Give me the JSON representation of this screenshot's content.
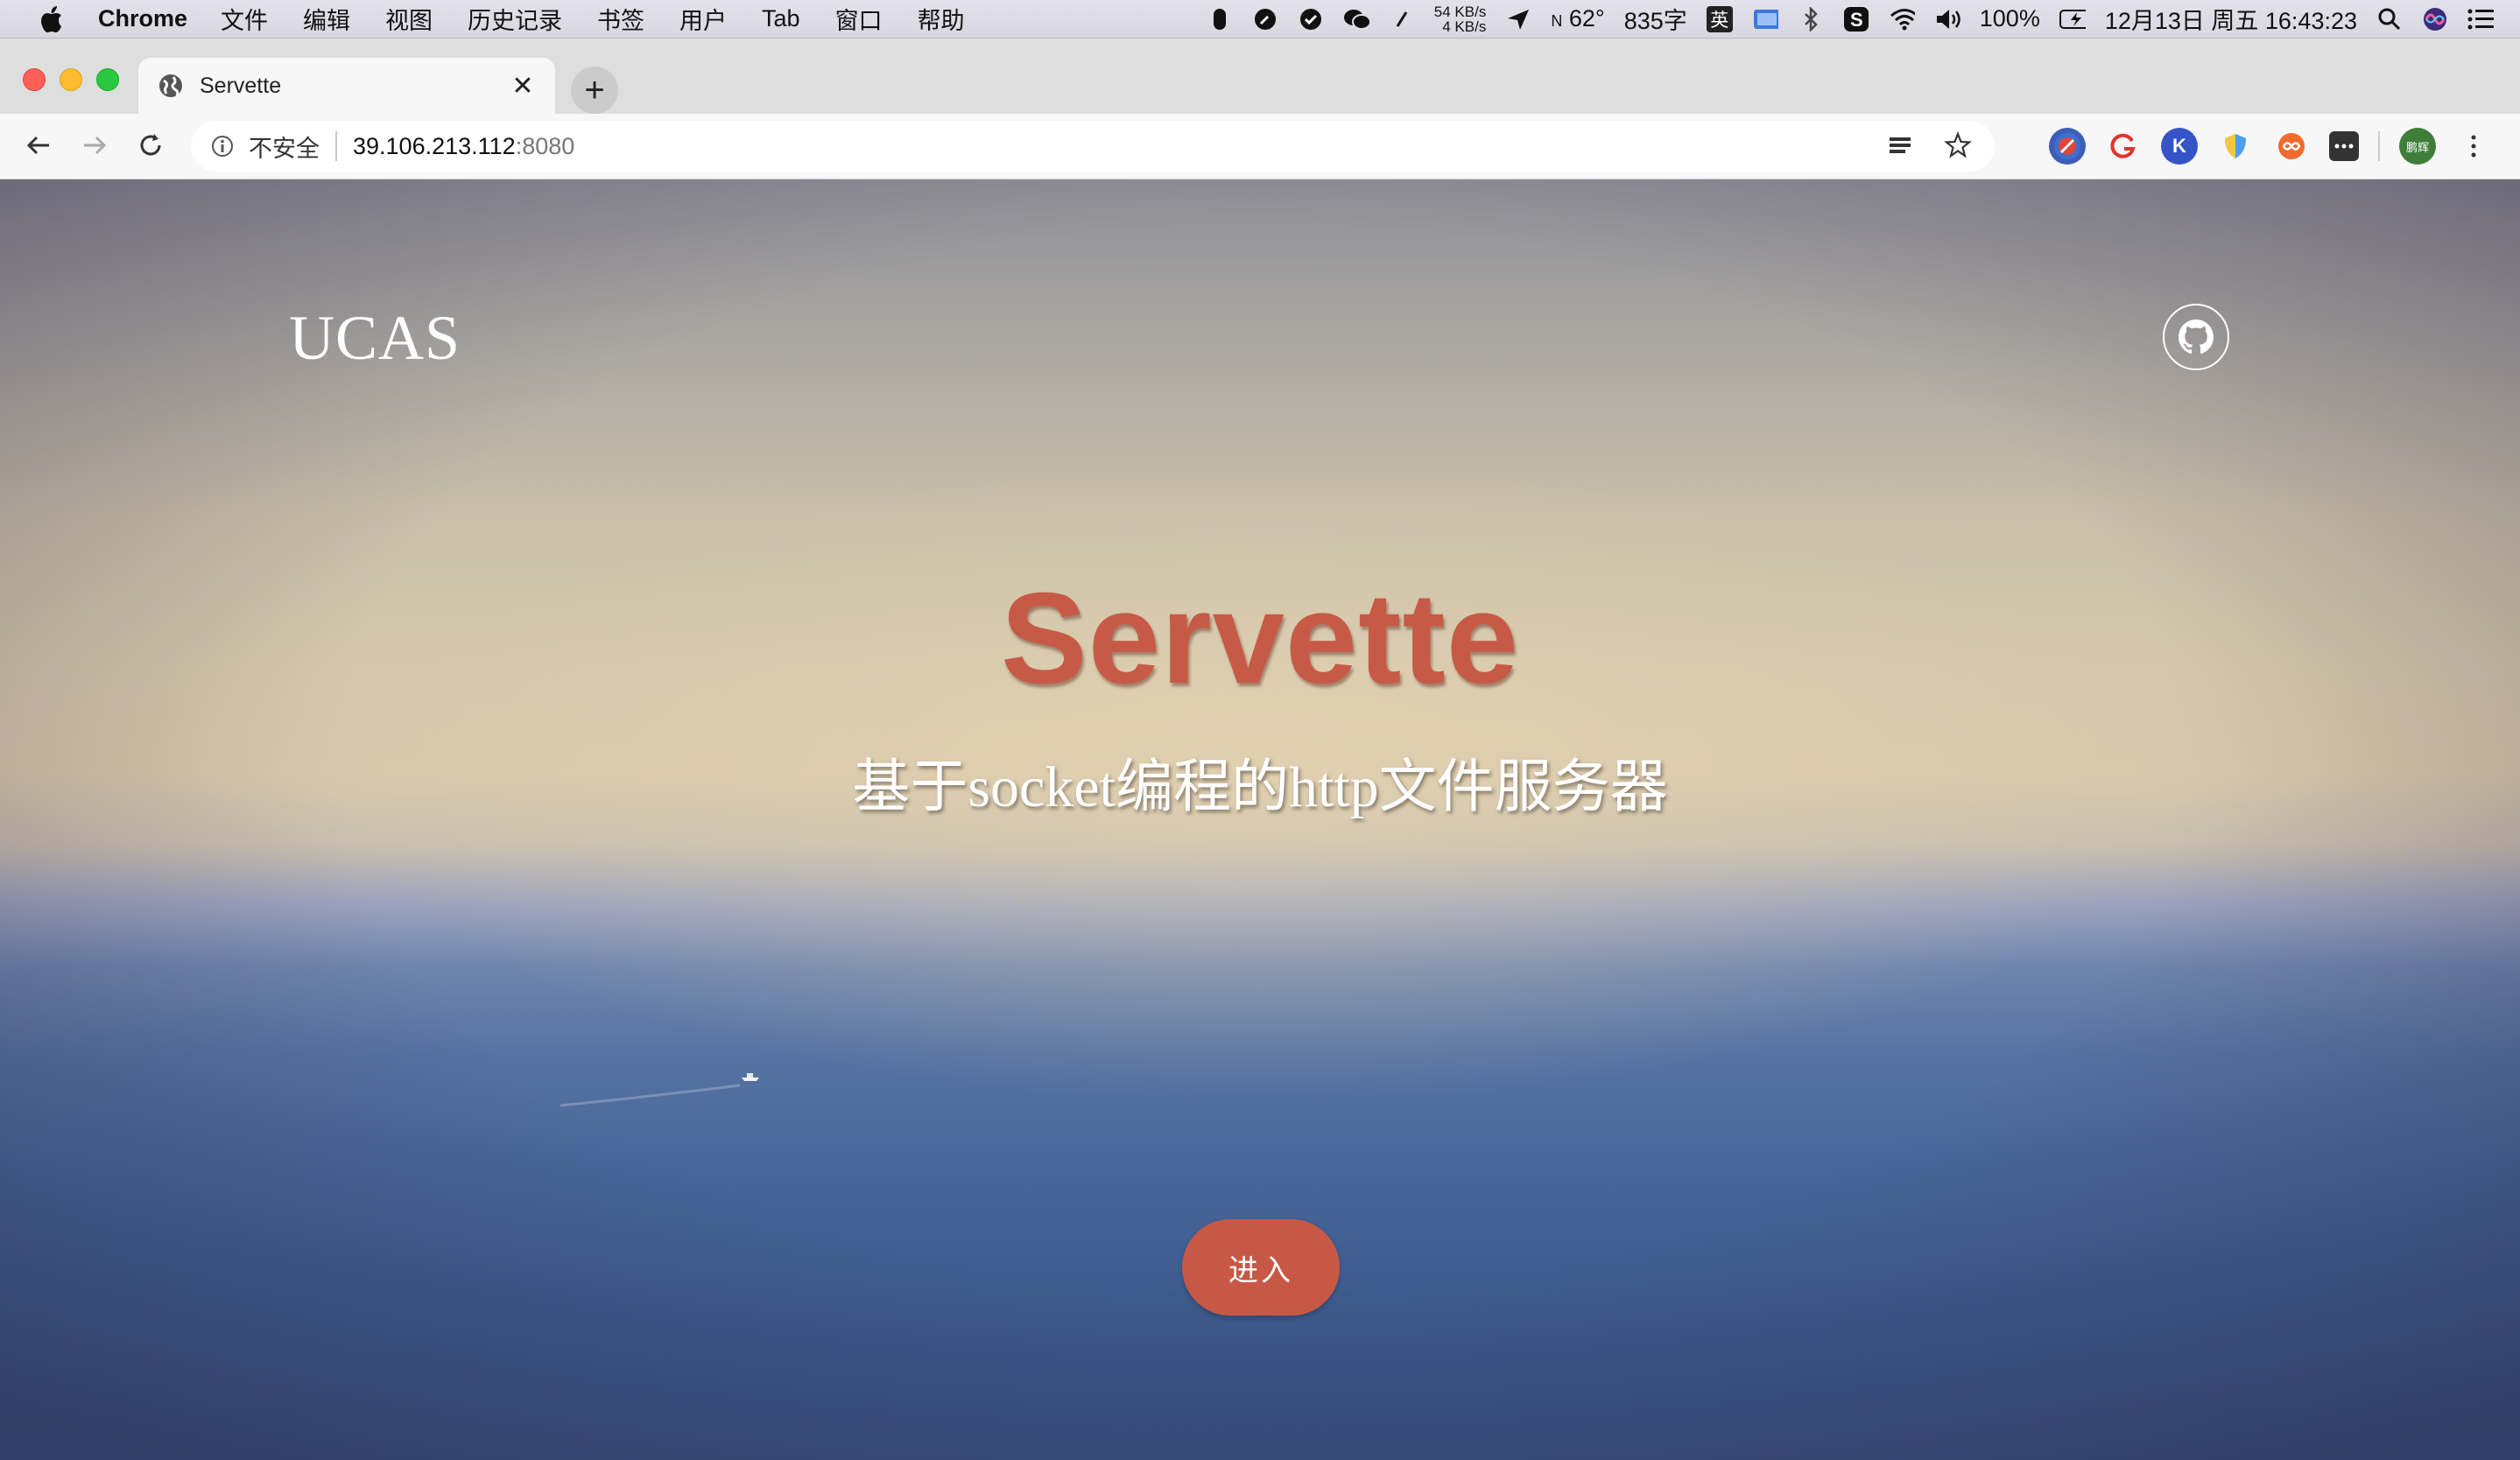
{
  "menubar": {
    "app_name": "Chrome",
    "menus": [
      "文件",
      "编辑",
      "视图",
      "历史记录",
      "书签",
      "用户",
      "Tab",
      "窗口",
      "帮助"
    ],
    "net_up": "54 KB/s",
    "net_down": "4 KB/s",
    "temperature": "62°",
    "word_count": "835字",
    "ime": "英",
    "battery": "100%",
    "datetime": "12月13日 周五  16:43:23"
  },
  "browser": {
    "tab_title": "Servette",
    "tab_close": "✕",
    "new_tab": "+",
    "security_label": "不安全",
    "url_host": "39.106.213.112",
    "url_port": ":8080",
    "profile_label": "鹏辉"
  },
  "page": {
    "brand": "UCAS",
    "title": "Servette",
    "subtitle": "基于socket编程的http文件服务器",
    "enter_button": "进入",
    "title_color": "#c75a46",
    "button_color": "#c85846"
  }
}
